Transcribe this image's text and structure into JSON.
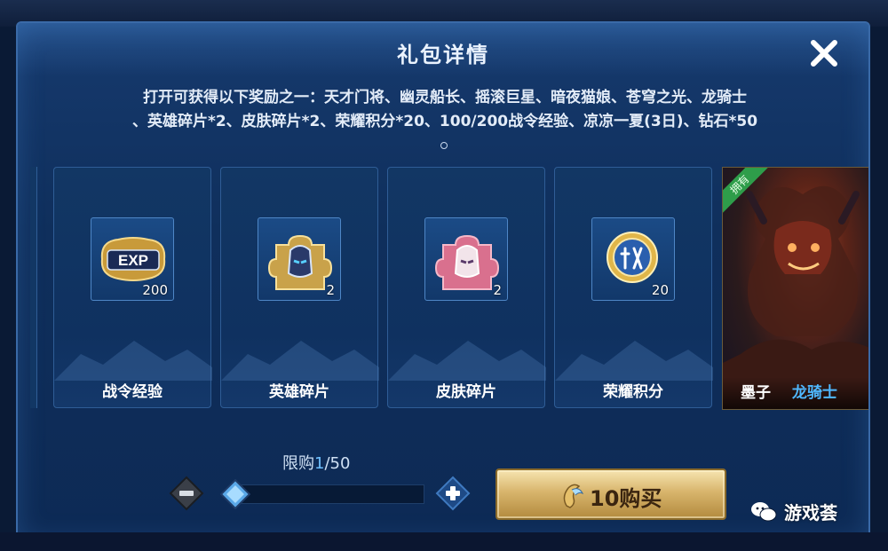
{
  "dialog": {
    "title": "礼包详情",
    "description_line1": "打开可获得以下奖励之一：天才门将、幽灵船长、摇滚巨星、暗夜猫娘、苍穹之光、龙骑士",
    "description_line2": "、英雄碎片*2、皮肤碎片*2、荣耀积分*20、100/200战令经验、凉凉一夏(3日)、钻石*50",
    "description_line3": "。"
  },
  "rewards": [
    {
      "label": "战令经验",
      "count": "200",
      "icon": "exp-icon"
    },
    {
      "label": "英雄碎片",
      "count": "2",
      "icon": "hero-shard-icon"
    },
    {
      "label": "皮肤碎片",
      "count": "2",
      "icon": "skin-shard-icon"
    },
    {
      "label": "荣耀积分",
      "count": "20",
      "icon": "honor-points-icon"
    }
  ],
  "skin": {
    "owned_tag": "拥有",
    "hero": "墨子",
    "name": "龙骑士"
  },
  "purchase": {
    "limit_prefix": "限购",
    "limit_current": "1",
    "limit_total": "/50",
    "buy_label": "10购买",
    "quantity_fraction": 0.0
  },
  "watermark": {
    "text": "游戏荟"
  },
  "colors": {
    "accent_blue": "#6fc0ff",
    "owned_green": "#2e9d4a",
    "buy_gold": "#d8b56c",
    "skin_name_blue": "#4fb8ff"
  }
}
